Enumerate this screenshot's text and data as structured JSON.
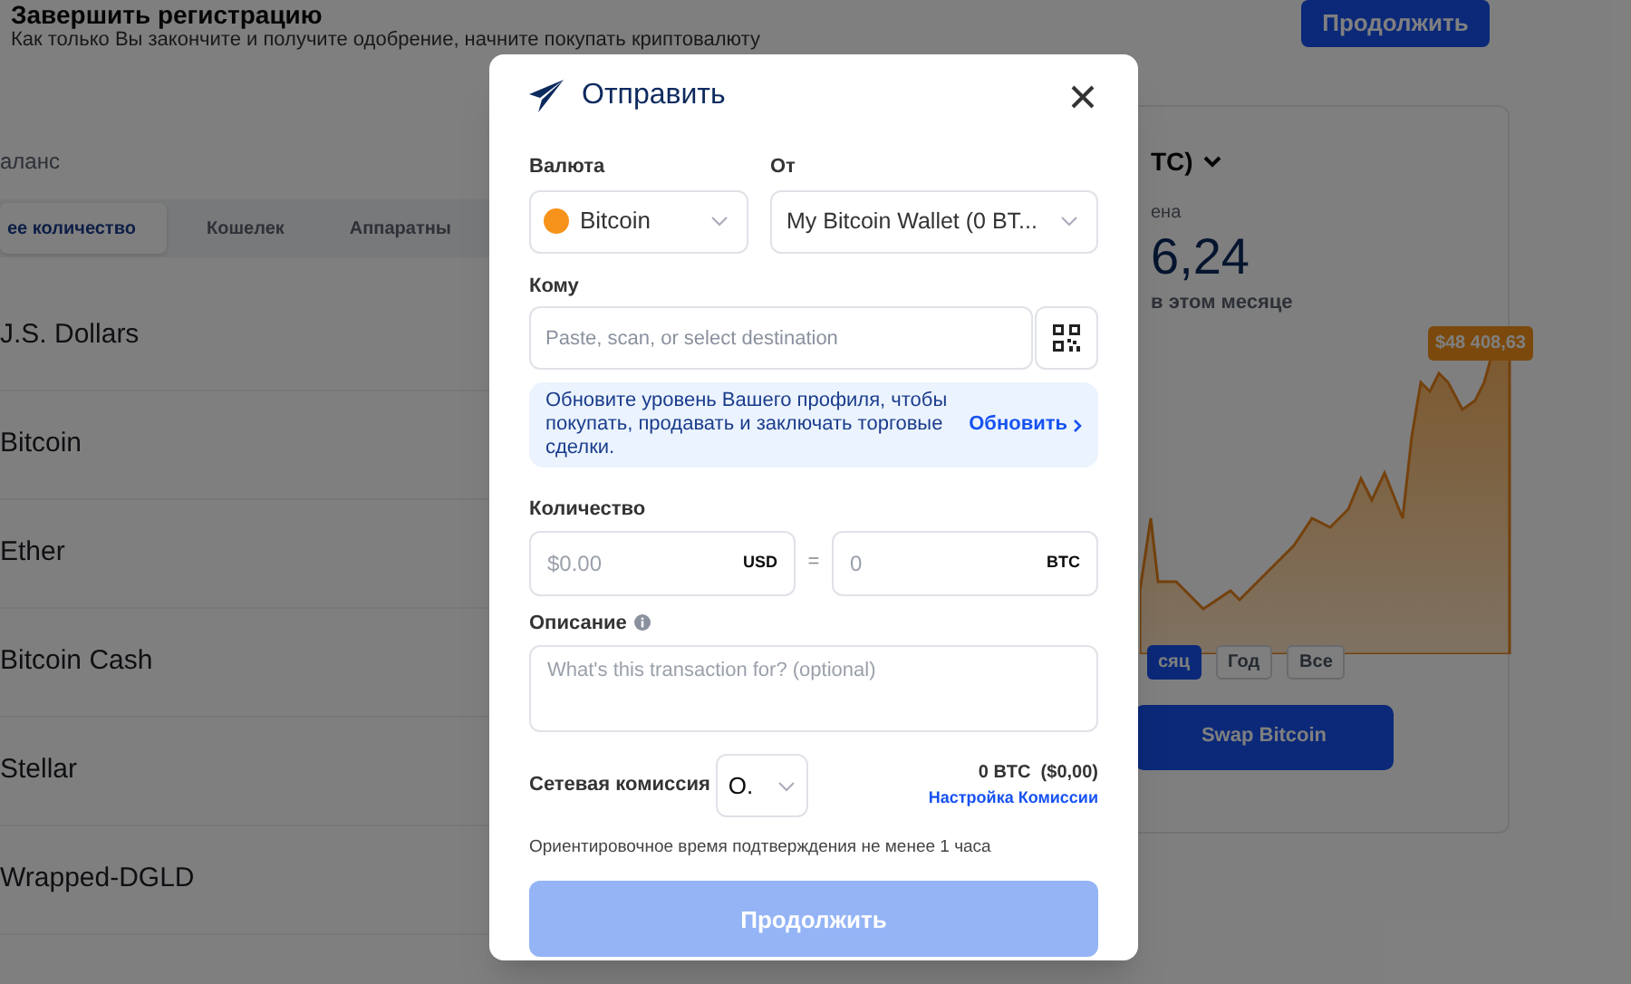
{
  "background": {
    "registration": {
      "title": "Завершить регистрацию",
      "subtitle": "Как только Вы закончите и получите одобрение, начните покупать криптовалюту",
      "button": "Продолжить"
    },
    "balance": {
      "title": "аланс",
      "tabs": [
        {
          "label": "ее количество",
          "selected": true
        },
        {
          "label": "Кошелек",
          "selected": false
        },
        {
          "label": "Аппаратны",
          "selected": false
        }
      ],
      "assets": [
        {
          "name": "J.S. Dollars"
        },
        {
          "name": "Bitcoin"
        },
        {
          "name": "Ether"
        },
        {
          "name": "Bitcoin Cash"
        },
        {
          "name": "Stellar"
        },
        {
          "name": "Wrapped-DGLD"
        }
      ]
    },
    "price_card": {
      "asset_selector": "TC)",
      "price_label": "ена",
      "price": "6,24",
      "change": "в этом месяце",
      "price_tag": "$48 408,63",
      "ranges": [
        {
          "label": "сяц",
          "selected": true
        },
        {
          "label": "Год",
          "selected": false
        },
        {
          "label": "Все",
          "selected": false
        }
      ],
      "swap_button": "Swap Bitcoin"
    }
  },
  "modal": {
    "title": "Отправить",
    "currency": {
      "label": "Валюта",
      "value": "Bitcoin"
    },
    "from": {
      "label": "От",
      "value": "My Bitcoin Wallet (0 BT..."
    },
    "to": {
      "label": "Кому",
      "placeholder": "Paste, scan, or select destination"
    },
    "notice": {
      "text": "Обновите уровень Вашего профиля, чтобы покупать, продавать и заключать торговые сделки.",
      "link": "Обновить"
    },
    "amount": {
      "label": "Количество",
      "usd_placeholder": "$0.00",
      "usd_unit": "USD",
      "equals": "=",
      "btc_placeholder": "0",
      "btc_unit": "BTC"
    },
    "description": {
      "label": "Описание",
      "placeholder": "What's this transaction for? (optional)"
    },
    "fee": {
      "label": "Сетевая комиссия",
      "value": "O.",
      "amount": "0 BTC  ($0,00)",
      "settings_link": "Настройка Комиссии"
    },
    "eta": "Ориентировочное время подтверждения не менее 1 часа",
    "submit": {
      "label": "Продолжить",
      "disabled": true
    }
  }
}
